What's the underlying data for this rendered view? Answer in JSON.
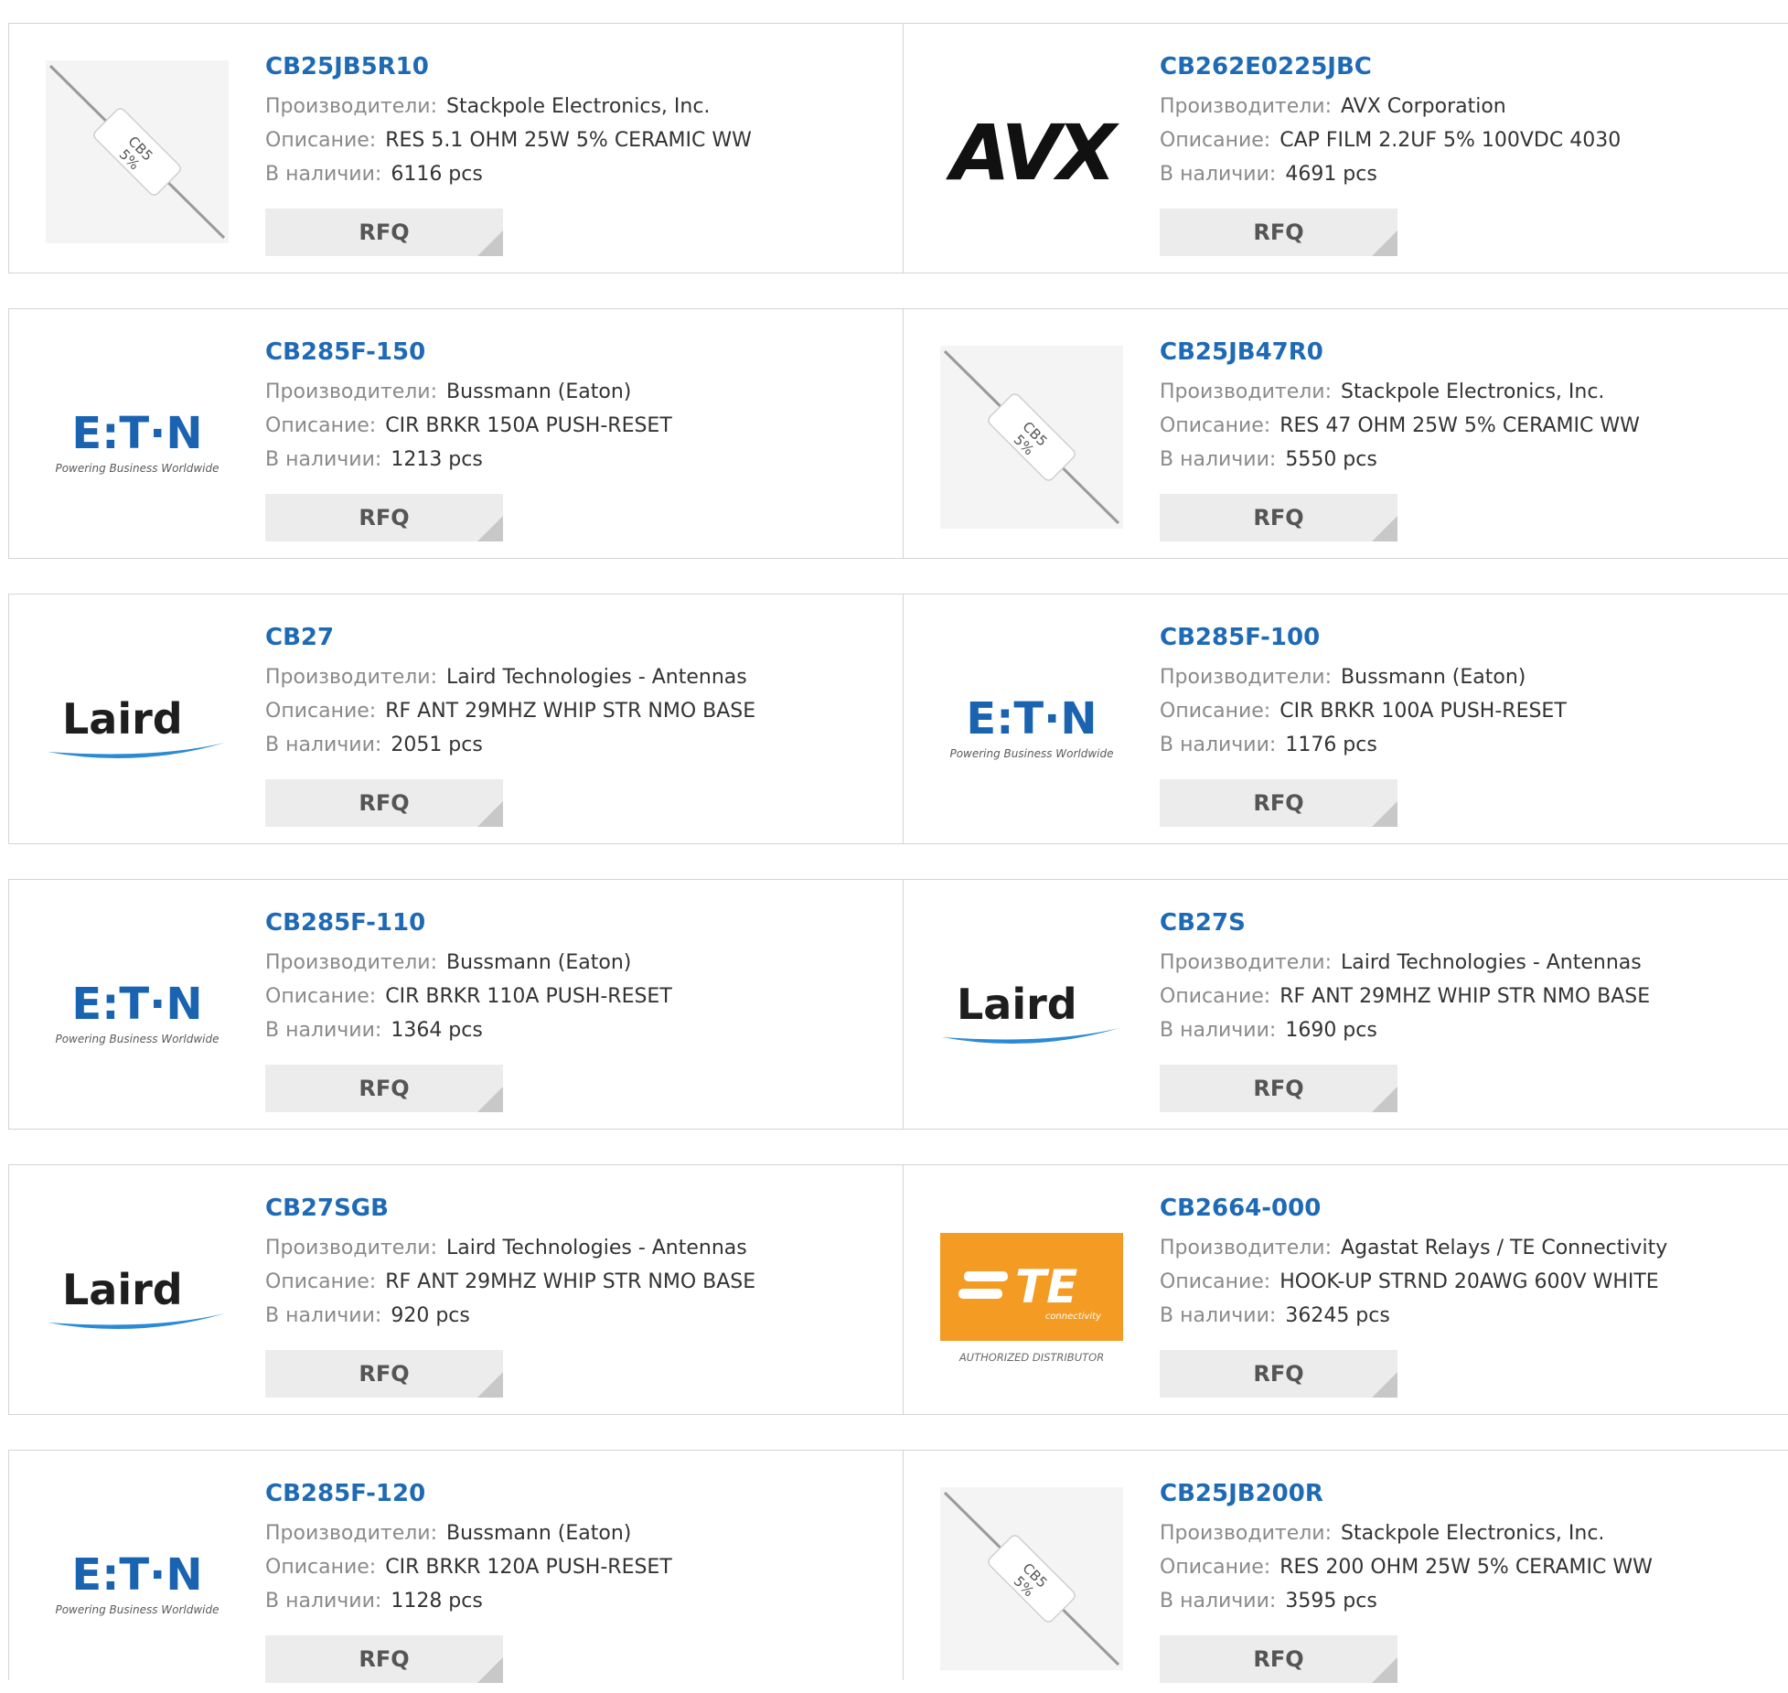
{
  "labels": {
    "manufacturer": "Производители:",
    "description": "Описание:",
    "stock": "В наличии:"
  },
  "rfq_label": "RFQ",
  "logo_text": {
    "eaton": "E:T·N",
    "eaton_tagline": "Powering Business Worldwide",
    "avx": "AVX",
    "laird": "Laird",
    "te": "TE",
    "te_sub": "connectivity",
    "te_dist": "AUTHORIZED DISTRIBUTOR",
    "resistor": "CB5 5%"
  },
  "products": [
    {
      "part": "CB25JB5R10",
      "manufacturer": "Stackpole Electronics, Inc.",
      "description": "RES 5.1 OHM 25W 5% CERAMIC WW",
      "stock": "6116 pcs",
      "logo": "resistor"
    },
    {
      "part": "CB262E0225JBC",
      "manufacturer": "AVX Corporation",
      "description": "CAP FILM 2.2UF 5% 100VDC 4030",
      "stock": "4691 pcs",
      "logo": "avx"
    },
    {
      "part": "CB285F-150",
      "manufacturer": "Bussmann (Eaton)",
      "description": "CIR BRKR 150A PUSH-RESET",
      "stock": "1213 pcs",
      "logo": "eaton"
    },
    {
      "part": "CB25JB47R0",
      "manufacturer": "Stackpole Electronics, Inc.",
      "description": "RES 47 OHM 25W 5% CERAMIC WW",
      "stock": "5550 pcs",
      "logo": "resistor"
    },
    {
      "part": "CB27",
      "manufacturer": "Laird Technologies - Antennas",
      "description": "RF ANT 29MHZ WHIP STR NMO BASE",
      "stock": "2051 pcs",
      "logo": "laird"
    },
    {
      "part": "CB285F-100",
      "manufacturer": "Bussmann (Eaton)",
      "description": "CIR BRKR 100A PUSH-RESET",
      "stock": "1176 pcs",
      "logo": "eaton"
    },
    {
      "part": "CB285F-110",
      "manufacturer": "Bussmann (Eaton)",
      "description": "CIR BRKR 110A PUSH-RESET",
      "stock": "1364 pcs",
      "logo": "eaton"
    },
    {
      "part": "CB27S",
      "manufacturer": "Laird Technologies - Antennas",
      "description": "RF ANT 29MHZ WHIP STR NMO BASE",
      "stock": "1690 pcs",
      "logo": "laird"
    },
    {
      "part": "CB27SGB",
      "manufacturer": "Laird Technologies - Antennas",
      "description": "RF ANT 29MHZ WHIP STR NMO BASE",
      "stock": "920 pcs",
      "logo": "laird"
    },
    {
      "part": "CB2664-000",
      "manufacturer": "Agastat Relays / TE Connectivity",
      "description": "HOOK-UP STRND 20AWG 600V WHITE",
      "stock": "36245 pcs",
      "logo": "te"
    },
    {
      "part": "CB285F-120",
      "manufacturer": "Bussmann (Eaton)",
      "description": "CIR BRKR 120A PUSH-RESET",
      "stock": "1128 pcs",
      "logo": "eaton"
    },
    {
      "part": "CB25JB200R",
      "manufacturer": "Stackpole Electronics, Inc.",
      "description": "RES 200 OHM 25W 5% CERAMIC WW",
      "stock": "3595 pcs",
      "logo": "resistor"
    }
  ]
}
